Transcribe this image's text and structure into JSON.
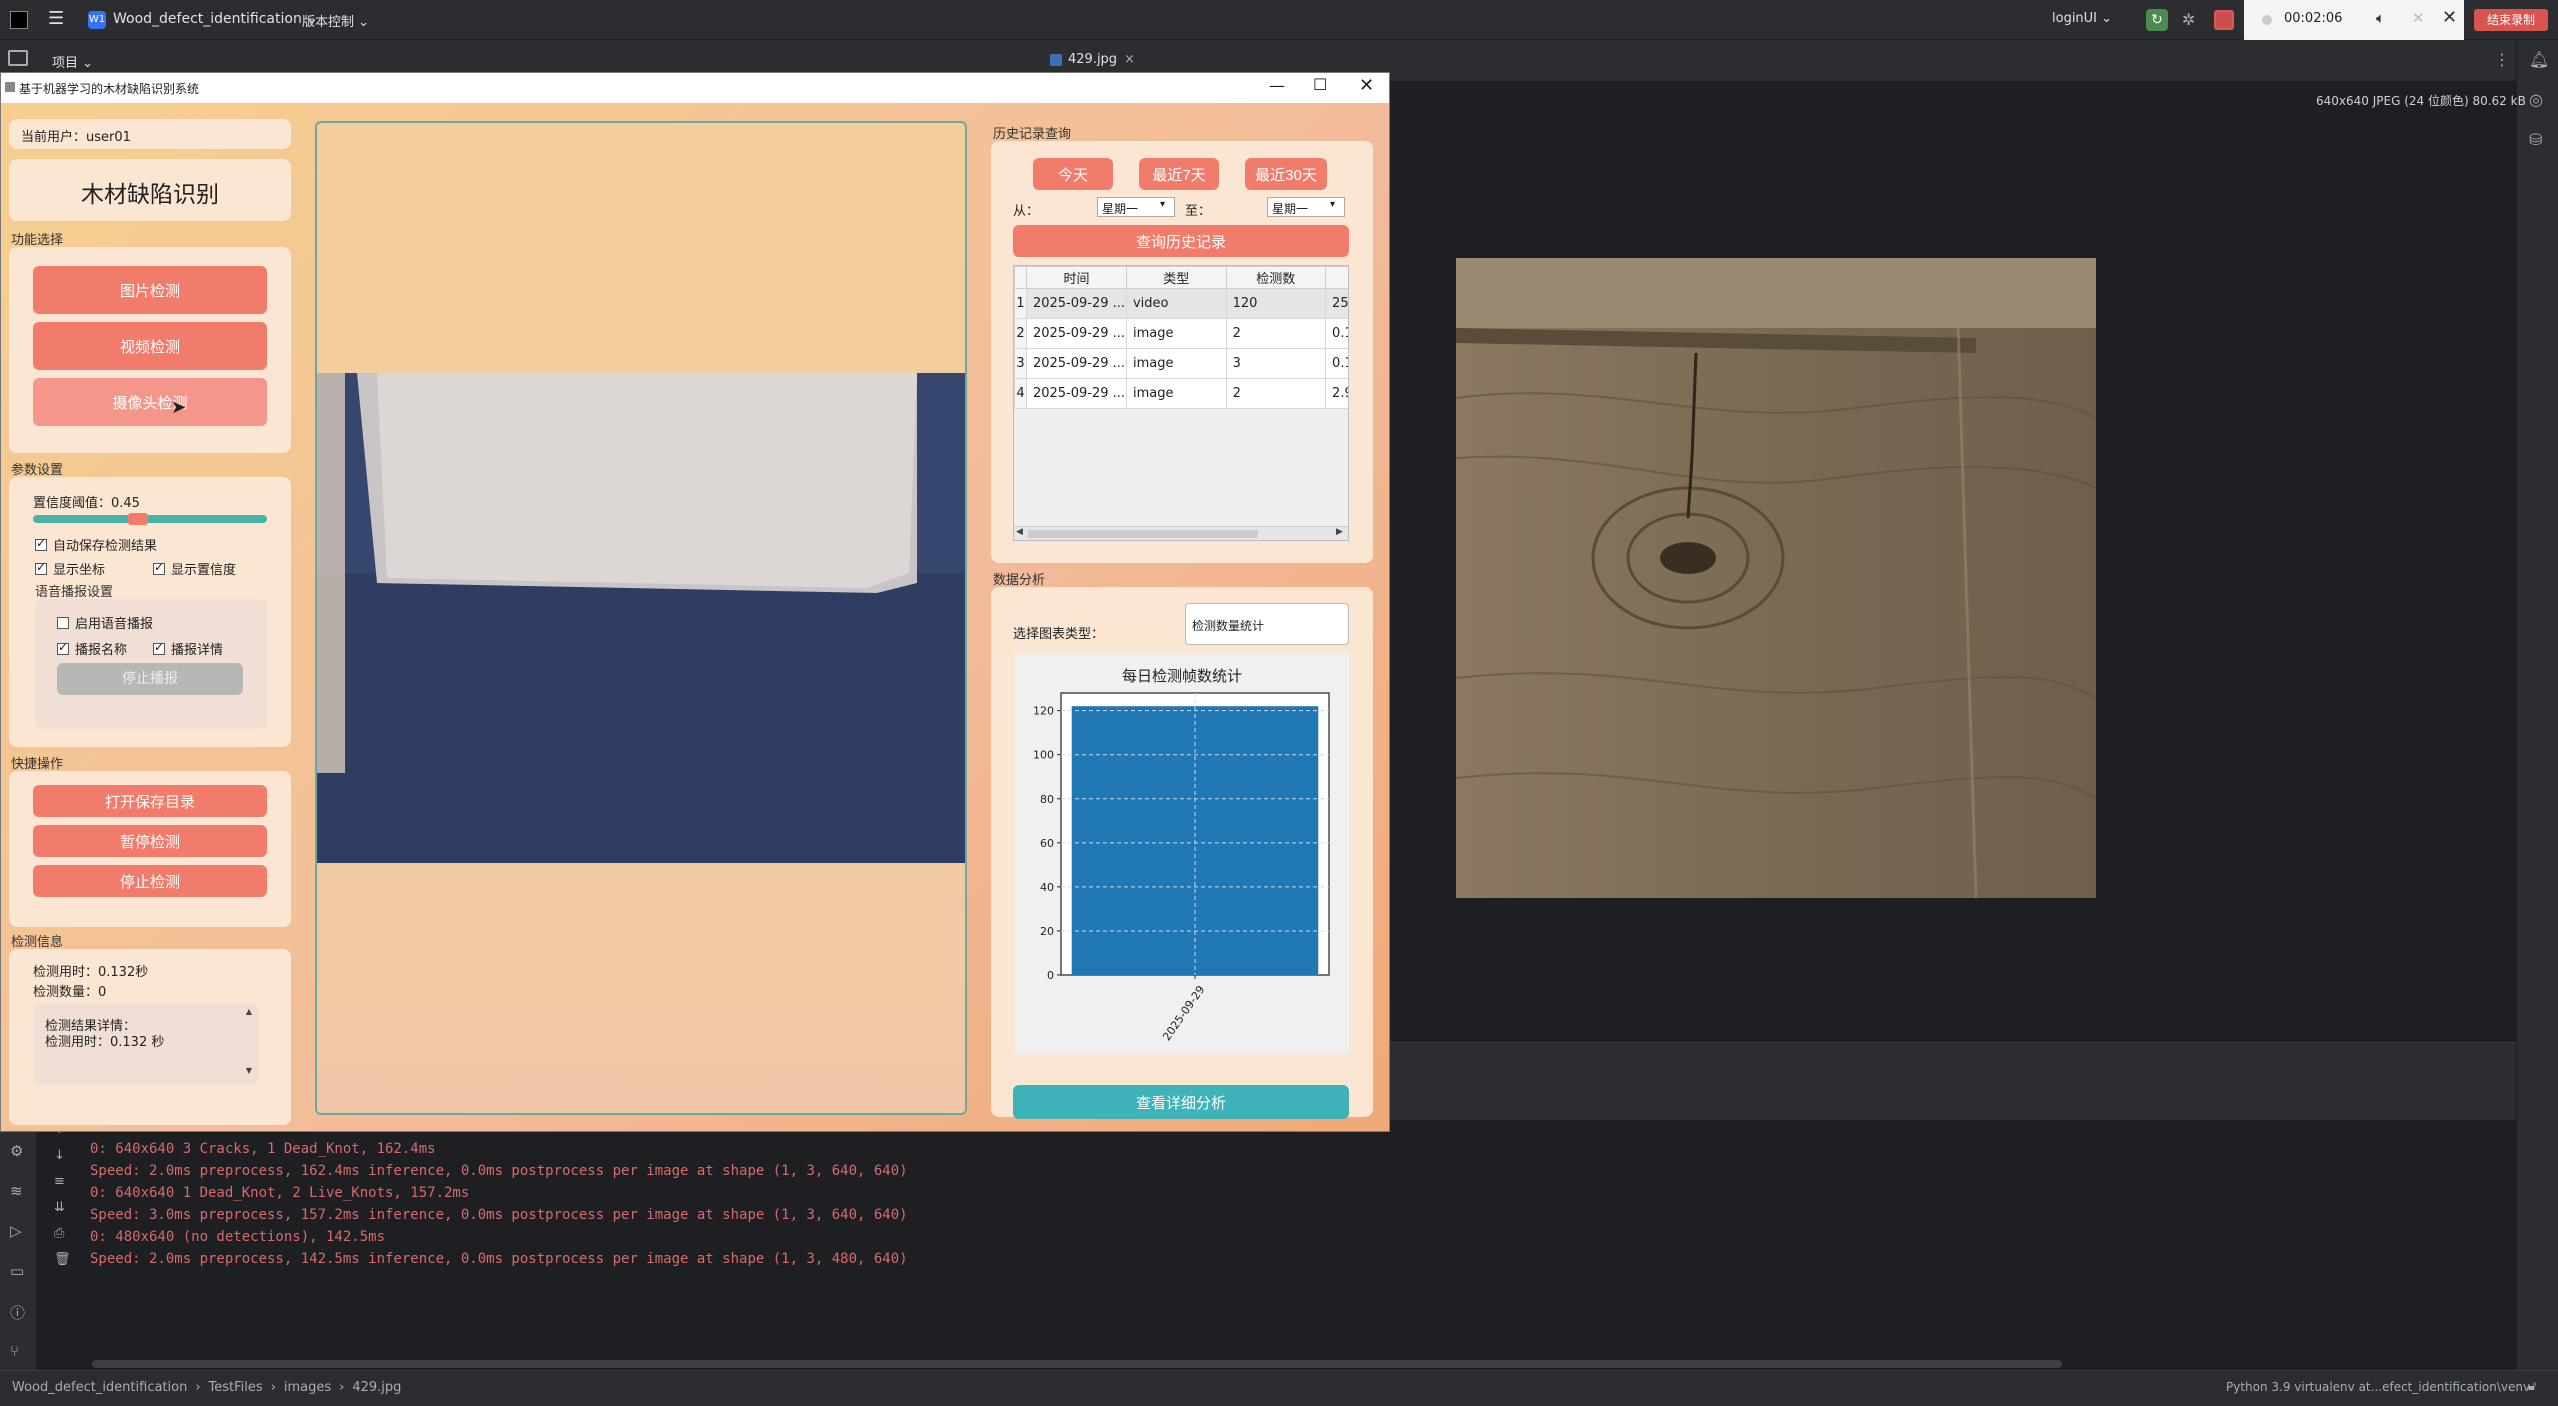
{
  "ide": {
    "project_badge": "W1",
    "project_name": "Wood_defect_identification",
    "vcs": "版本控制",
    "run_config": "loginUI",
    "rec_time": "00:02:06",
    "rec_stop": "结束录制",
    "project_label": "项目",
    "editor_tab": "429.jpg",
    "image_info": "640x640 JPEG (24 位颜色) 80.62 kB",
    "console_lines": [
      "0: 640x640 3 Cracks, 1 Dead_Knot, 162.4ms",
      "Speed: 2.0ms preprocess, 162.4ms inference, 0.0ms postprocess per image at shape (1, 3, 640, 640)",
      "",
      "0: 640x640 1 Dead_Knot, 2 Live_Knots, 157.2ms",
      "Speed: 3.0ms preprocess, 157.2ms inference, 0.0ms postprocess per image at shape (1, 3, 640, 640)",
      "",
      "0: 480x640 (no detections), 142.5ms",
      "Speed: 2.0ms preprocess, 142.5ms inference, 0.0ms postprocess per image at shape (1, 3, 480, 640)"
    ],
    "breadcrumb": [
      "Wood_defect_identification",
      "TestFiles",
      "images",
      "429.jpg"
    ],
    "interpreter": "Python 3.9 virtualenv at...efect_identification\\venv"
  },
  "app": {
    "window_title": "基于机器学习的木材缺陷识别系统",
    "current_user": "当前用户：user01",
    "heading": "木材缺陷识别",
    "func_section": "功能选择",
    "btn_image": "图片检测",
    "btn_video": "视频检测",
    "btn_camera": "摄像头检测",
    "param_section": "参数设置",
    "conf_label": "置信度阈值：0.45",
    "conf_value": 0.45,
    "cb_autosave": "自动保存检测结果",
    "cb_coords": "显示坐标",
    "cb_conf": "显示置信度",
    "voice_section": "语音播报设置",
    "cb_voice": "启用语音播报",
    "cb_name": "播报名称",
    "cb_detail": "播报详情",
    "btn_stop_voice": "停止播报",
    "quick_section": "快捷操作",
    "btn_open_dir": "打开保存目录",
    "btn_pause": "暂停检测",
    "btn_stop": "停止检测",
    "info_section": "检测信息",
    "info_time": "检测用时：0.132秒",
    "info_count": "检测数量：0",
    "detail_title": "检测结果详情：",
    "detail_time": "检测用时：0.132 秒",
    "history_section": "历史记录查询",
    "btn_today": "今天",
    "btn_7days": "最近7天",
    "btn_30days": "最近30天",
    "from_label": "从：",
    "to_label": "至：",
    "from_value": "星期一",
    "to_value": "星期一",
    "btn_query": "查询历史记录",
    "table_headers": [
      "时间",
      "类型",
      "检测数"
    ],
    "table_rows": [
      [
        "1",
        "2025-09-29 ...",
        "video",
        "120",
        "25."
      ],
      [
        "2",
        "2025-09-29 ...",
        "image",
        "2",
        "0.1"
      ],
      [
        "3",
        "2025-09-29 ...",
        "image",
        "3",
        "0.1"
      ],
      [
        "4",
        "2025-09-29 ...",
        "image",
        "2",
        "2.9"
      ]
    ],
    "analysis_section": "数据分析",
    "chart_type_label": "选择图表类型：",
    "chart_type_value": "检测数量统计",
    "btn_detail_analysis": "查看详细分析"
  },
  "chart_data": {
    "type": "bar",
    "title": "每日检测帧数统计",
    "categories": [
      "2025-09-29"
    ],
    "values": [
      122
    ],
    "ylim": [
      0,
      128
    ],
    "yticks": [
      0,
      20,
      40,
      60,
      80,
      100,
      120
    ],
    "xlabel": "",
    "ylabel": "",
    "grid": true,
    "bar_color": "#1f77b4"
  }
}
